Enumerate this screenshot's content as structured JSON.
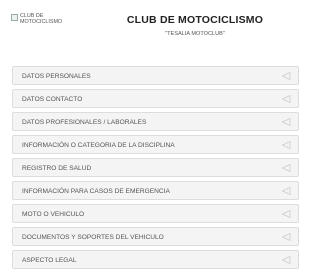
{
  "header": {
    "logo_alt": "CLUB DE\nMOTOCICLISMO",
    "title": "CLUB DE MOTOCICLISMO",
    "subtitle": "\"TESALIA MOTOCLUB\""
  },
  "accordion": {
    "items": [
      {
        "label": "DATOS PERSONALES",
        "icon": "chevron-left-icon"
      },
      {
        "label": "DATOS CONTACTO",
        "icon": "chevron-left-icon"
      },
      {
        "label": "DATOS PROFESIONALES / LABORALES",
        "icon": "chevron-left-icon"
      },
      {
        "label": "INFORMACIÓN O CATEGORIA DE LA DISCIPLINA",
        "icon": "chevron-left-icon"
      },
      {
        "label": "REGISTRO DE SALUD",
        "icon": "chevron-left-icon"
      },
      {
        "label": "INFORMACIÓN PARA CASOS DE EMERGENCIA",
        "icon": "chevron-left-icon"
      },
      {
        "label": "MOTO O VEHICULO",
        "icon": "chevron-left-icon"
      },
      {
        "label": "DOCUMENTOS Y SOPORTES DEL VEHICULO",
        "icon": "chevron-left-icon"
      },
      {
        "label": "ASPECTO LEGAL",
        "icon": "chevron-left-icon"
      }
    ]
  },
  "colors": {
    "panel_background": "#f4f4f4",
    "panel_border": "#dddddd",
    "arrow": "#cccccc",
    "title_text": "#222222"
  }
}
